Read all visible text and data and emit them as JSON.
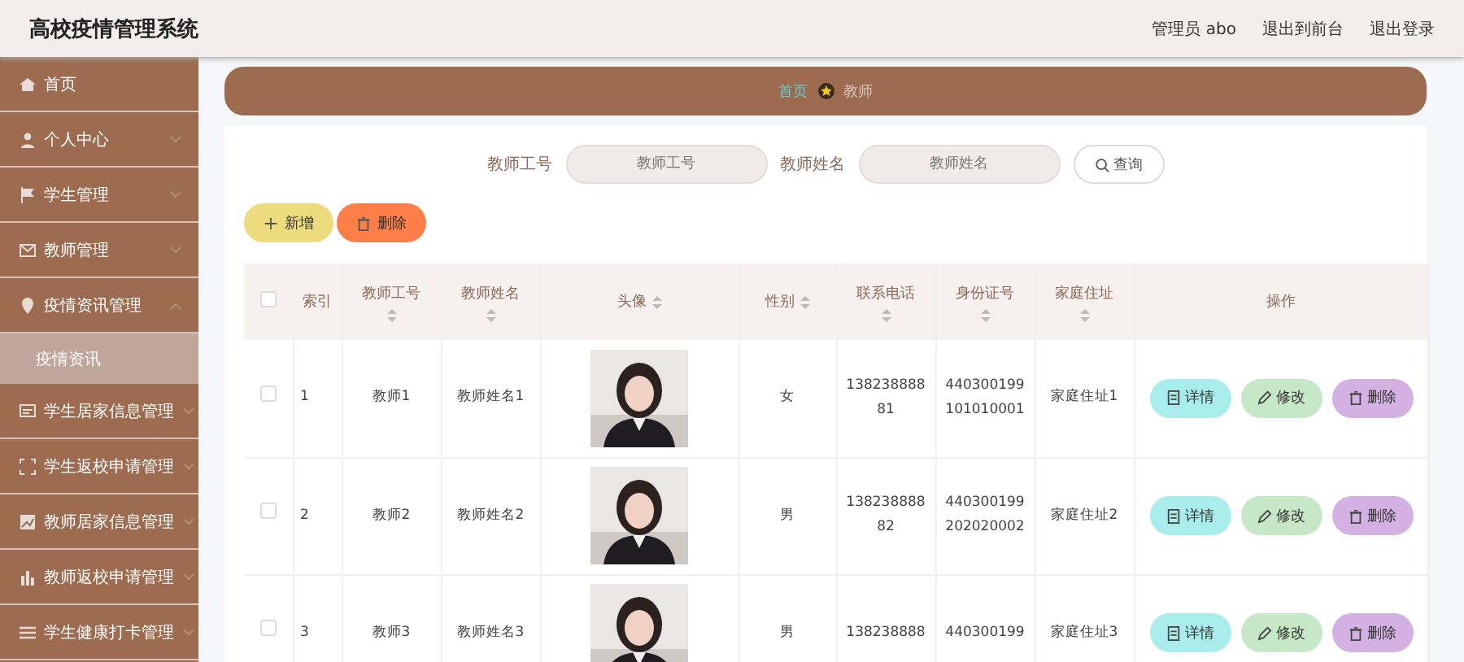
{
  "header": {
    "title": "高校疫情管理系统",
    "links": [
      "管理员 abo",
      "退出到前台",
      "退出登录"
    ]
  },
  "sidebar": {
    "items": [
      {
        "label": "首页"
      },
      {
        "label": "个人中心",
        "expanded": false
      },
      {
        "label": "学生管理",
        "expanded": false
      },
      {
        "label": "教师管理",
        "expanded": false
      },
      {
        "label": "疫情资讯管理",
        "expanded": true,
        "children": [
          {
            "label": "疫情资讯",
            "selected": true
          }
        ]
      },
      {
        "label": "学生居家信息管理",
        "expanded": false
      },
      {
        "label": "学生返校申请管理",
        "expanded": false
      },
      {
        "label": "教师居家信息管理",
        "expanded": false
      },
      {
        "label": "教师返校申请管理",
        "expanded": false
      },
      {
        "label": "学生健康打卡管理",
        "expanded": false
      }
    ]
  },
  "breadcrumb": [
    "首页",
    "教师"
  ],
  "search": {
    "fields": [
      {
        "label": "教师工号",
        "placeholder": "教师工号"
      },
      {
        "label": "教师姓名",
        "placeholder": "教师姓名"
      }
    ],
    "button": "查询"
  },
  "actions": [
    {
      "kind": "add",
      "label": "新增"
    },
    {
      "kind": "delete",
      "label": "删除"
    }
  ],
  "table": {
    "header_checked": false,
    "columns": [
      {
        "label": "索引",
        "sortable": false
      },
      {
        "label": "教师工号",
        "sortable": true
      },
      {
        "label": "教师姓名",
        "sortable": true
      },
      {
        "label": "头像",
        "sortable": true
      },
      {
        "label": "性别",
        "sortable": true
      },
      {
        "label": "联系电话",
        "sortable": true
      },
      {
        "label": "身份证号",
        "sortable": true
      },
      {
        "label": "家庭住址",
        "sortable": true
      },
      {
        "label": "操作",
        "sortable": false
      }
    ],
    "rows": [
      {
        "checked": false,
        "cells": [
          "1",
          "教师1",
          "教师姓名1",
          {
            "kind": "picture"
          },
          "女",
          "13823888881",
          "440300199101010001",
          "家庭住址1"
        ],
        "buttons": [
          {
            "kind": "detail",
            "label": "详情"
          },
          {
            "kind": "edit",
            "label": "修改"
          },
          {
            "kind": "delete",
            "label": "删除"
          }
        ]
      },
      {
        "checked": false,
        "cells": [
          "2",
          "教师2",
          "教师姓名2",
          {
            "kind": "picture"
          },
          "男",
          "13823888882",
          "440300199202020002",
          "家庭住址2"
        ],
        "buttons": [
          {
            "kind": "detail",
            "label": "详情"
          },
          {
            "kind": "edit",
            "label": "修改"
          },
          {
            "kind": "delete",
            "label": "删除"
          }
        ]
      },
      {
        "checked": false,
        "cells": [
          "3",
          "教师3",
          "教师姓名3",
          {
            "kind": "picture"
          },
          "男",
          "138238888",
          "440300199",
          "家庭住址3"
        ],
        "buttons": [
          {
            "kind": "detail",
            "label": "详情"
          },
          {
            "kind": "edit",
            "label": "修改"
          },
          {
            "kind": "delete",
            "label": "删除"
          }
        ]
      }
    ]
  }
}
